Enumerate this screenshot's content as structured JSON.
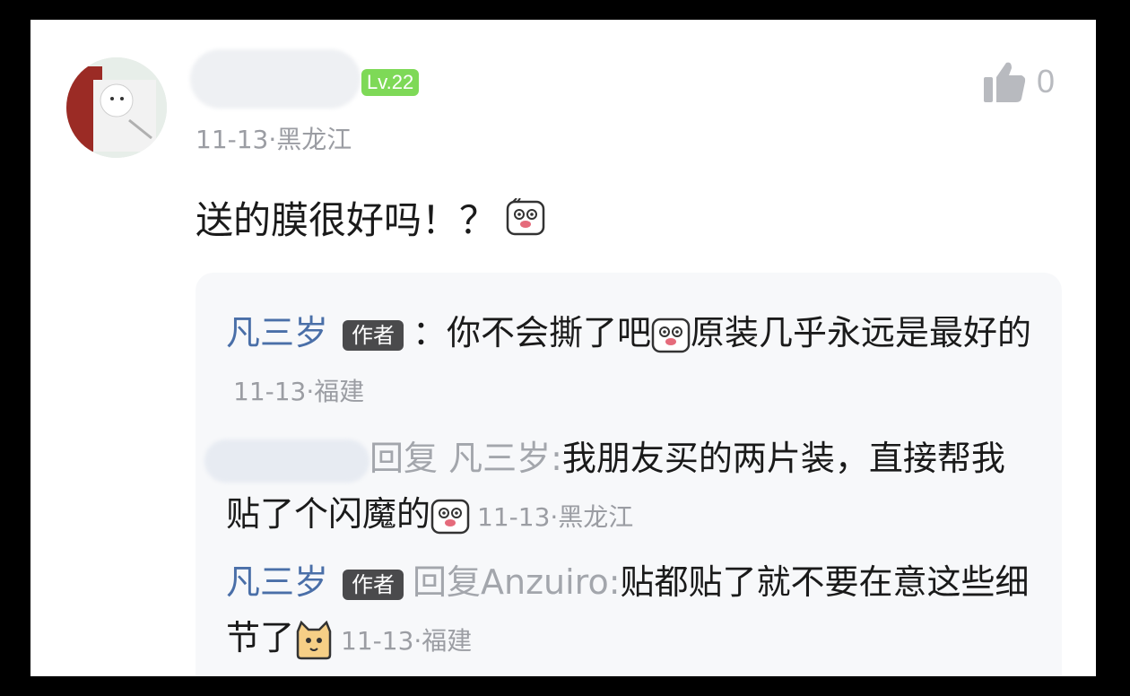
{
  "user": {
    "level": "Lv.22",
    "meta": "11-13·黑龙江",
    "like_count": "0"
  },
  "comment": {
    "text": "送的膜很好吗！？"
  },
  "replies": [
    {
      "author": "凡三岁",
      "badge": "作者",
      "text_part1": "：你不会撕了吧",
      "text_part2": "原装几乎永远是最好的",
      "time": "11-13·福建"
    },
    {
      "reply_prefix": "回复 凡三岁:",
      "text_part1": "我朋友买的两片装，直接帮我贴了个闪魔的",
      "time": "11-13·黑龙江"
    },
    {
      "author": "凡三岁",
      "badge": "作者",
      "reply_prefix": "回复Anzuiro:",
      "text_part1": "贴都贴了就不要在意这些细节了",
      "time": "11-13·福建"
    }
  ],
  "icons": {
    "like": "thumbs-up-icon",
    "emoji1": "surprised-face-emoji",
    "emoji2": "cat-face-emoji"
  }
}
